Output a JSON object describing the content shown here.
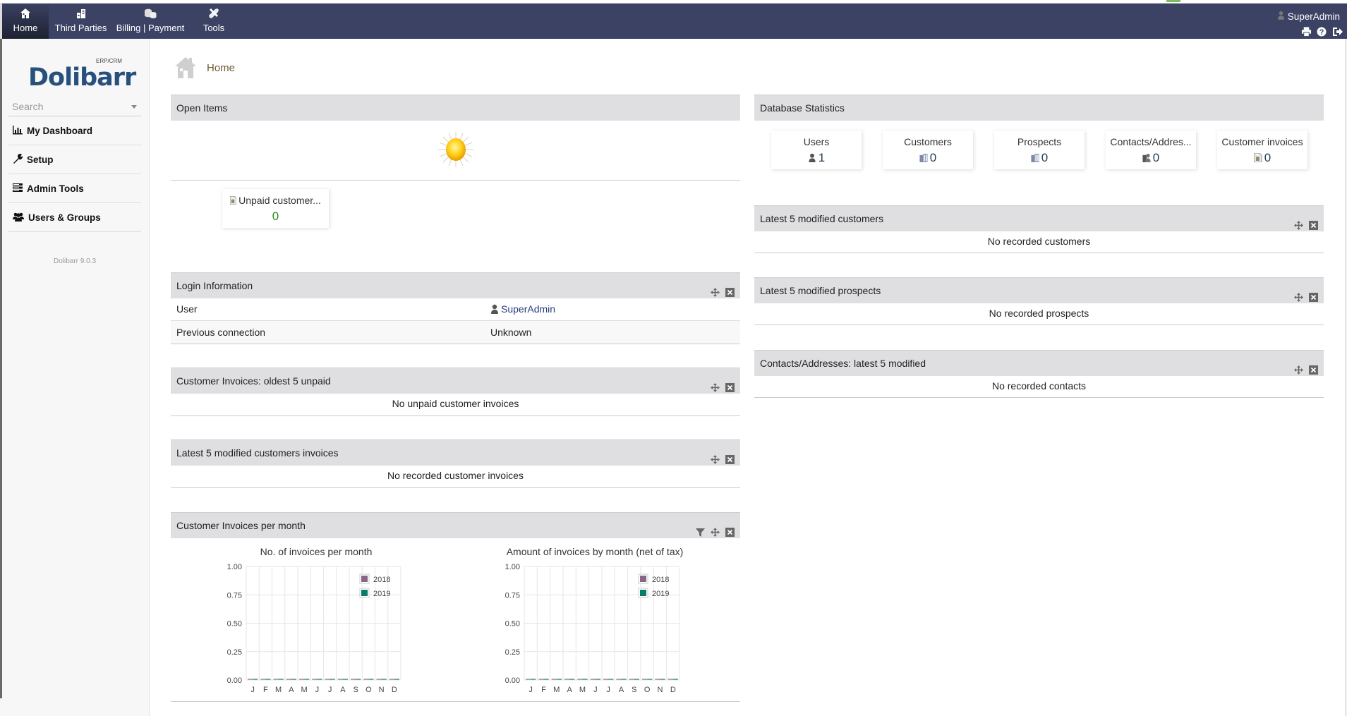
{
  "topbar": {
    "tabs": [
      {
        "label": "Home",
        "icon": "home-icon",
        "active": true
      },
      {
        "label": "Third Parties",
        "icon": "building-icon",
        "active": false
      },
      {
        "label": "Billing | Payment",
        "icon": "coins-icon",
        "active": false
      },
      {
        "label": "Tools",
        "icon": "tools-icon",
        "active": false
      }
    ],
    "user": "SuperAdmin",
    "icons": [
      "print-icon",
      "help-icon",
      "logout-icon"
    ]
  },
  "sidebar": {
    "logo": "Dolibarr",
    "logo_sub": "ERP/CRM",
    "search_placeholder": "Search",
    "items": [
      {
        "label": "My Dashboard",
        "icon": "chart-bar-icon"
      },
      {
        "label": "Setup",
        "icon": "wrench-icon"
      },
      {
        "label": "Admin Tools",
        "icon": "server-icon"
      },
      {
        "label": "Users & Groups",
        "icon": "users-icon"
      }
    ],
    "version": "Dolibarr 9.0.3"
  },
  "page": {
    "title": "Home"
  },
  "open_items": {
    "title": "Open Items",
    "weather": "sunny",
    "cards": [
      {
        "label": "Unpaid customer...",
        "value": "0",
        "value_color": "#2a8a2a"
      }
    ]
  },
  "login_info": {
    "title": "Login Information",
    "rows": [
      {
        "key": "User",
        "value": "SuperAdmin"
      },
      {
        "key": "Previous connection",
        "value": "Unknown"
      }
    ]
  },
  "boxes_left": [
    {
      "title": "Customer Invoices: oldest 5 unpaid",
      "empty": "No unpaid customer invoices"
    },
    {
      "title": "Latest 5 modified customers invoices",
      "empty": "No recorded customer invoices"
    }
  ],
  "invoices_per_month": {
    "title": "Customer Invoices per month"
  },
  "db_stats": {
    "title": "Database Statistics",
    "cards": [
      {
        "label": "Users",
        "value": "1",
        "icon": "user-icon"
      },
      {
        "label": "Customers",
        "value": "0",
        "icon": "company-icon"
      },
      {
        "label": "Prospects",
        "value": "0",
        "icon": "company-icon"
      },
      {
        "label": "Contacts/Addres...",
        "value": "0",
        "icon": "contact-icon"
      },
      {
        "label": "Customer invoices",
        "value": "0",
        "icon": "invoice-icon"
      }
    ]
  },
  "boxes_right": [
    {
      "title": "Latest 5 modified customers",
      "empty": "No recorded customers"
    },
    {
      "title": "Latest 5 modified prospects",
      "empty": "No recorded prospects"
    },
    {
      "title": "Contacts/Addresses: latest 5 modified",
      "empty": "No recorded contacts"
    }
  ],
  "chart_data": [
    {
      "type": "bar",
      "title": "No. of invoices per month",
      "categories": [
        "J",
        "F",
        "M",
        "A",
        "M",
        "J",
        "J",
        "A",
        "S",
        "O",
        "N",
        "D"
      ],
      "series": [
        {
          "name": "2018",
          "color": "#896688",
          "values": [
            0,
            0,
            0,
            0,
            0,
            0,
            0,
            0,
            0,
            0,
            0,
            0
          ]
        },
        {
          "name": "2019",
          "color": "#0b7b66",
          "values": [
            0,
            0,
            0,
            0,
            0,
            0,
            0,
            0,
            0,
            0,
            0,
            0
          ]
        }
      ],
      "yticks": [
        "1.00",
        "0.75",
        "0.50",
        "0.25",
        "0.00"
      ],
      "ylim": [
        0,
        1
      ],
      "xlabel": "",
      "ylabel": "",
      "grid": true,
      "legend": "top-right"
    },
    {
      "type": "bar",
      "title": "Amount of invoices by month (net of tax)",
      "categories": [
        "J",
        "F",
        "M",
        "A",
        "M",
        "J",
        "J",
        "A",
        "S",
        "O",
        "N",
        "D"
      ],
      "series": [
        {
          "name": "2018",
          "color": "#896688",
          "values": [
            0,
            0,
            0,
            0,
            0,
            0,
            0,
            0,
            0,
            0,
            0,
            0
          ]
        },
        {
          "name": "2019",
          "color": "#0b7b66",
          "values": [
            0,
            0,
            0,
            0,
            0,
            0,
            0,
            0,
            0,
            0,
            0,
            0
          ]
        }
      ],
      "yticks": [
        "1.00",
        "0.75",
        "0.50",
        "0.25",
        "0.00"
      ],
      "ylim": [
        0,
        1
      ],
      "xlabel": "",
      "ylabel": "",
      "grid": true,
      "legend": "top-right"
    }
  ]
}
